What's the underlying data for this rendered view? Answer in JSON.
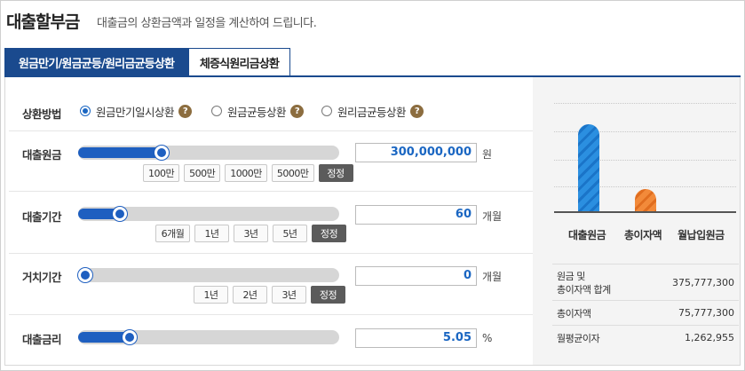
{
  "header": {
    "title": "대출할부금",
    "subtitle": "대출금의 상환금액과 일정을 계산하여 드립니다."
  },
  "tabs": [
    {
      "label": "원금만기/원금균등/원리금균등상환",
      "active": true
    },
    {
      "label": "체증식원리금상환",
      "active": false
    }
  ],
  "repayment": {
    "label": "상환방법",
    "options": [
      {
        "label": "원금만기일시상환",
        "checked": true
      },
      {
        "label": "원금균등상환",
        "checked": false
      },
      {
        "label": "원리금균등상환",
        "checked": false
      }
    ],
    "help_glyph": "?"
  },
  "principal": {
    "label": "대출원금",
    "value": "300,000,000",
    "unit": "원",
    "slider_level": 0.31,
    "buttons": [
      "100만",
      "500만",
      "1000만",
      "5000만"
    ],
    "reset": "정정"
  },
  "term": {
    "label": "대출기간",
    "value": "60",
    "unit": "개월",
    "slider_level": 0.14,
    "buttons": [
      "6개월",
      "1년",
      "3년",
      "5년"
    ],
    "reset": "정정"
  },
  "grace": {
    "label": "거치기간",
    "value": "0",
    "unit": "개월",
    "slider_level": 0.0,
    "buttons": [
      "1년",
      "2년",
      "3년"
    ],
    "reset": "정정"
  },
  "rate": {
    "label": "대출금리",
    "value": "5.05",
    "unit": "%",
    "slider_level": 0.18
  },
  "chart_data": {
    "type": "bar",
    "categories": [
      "대출원금",
      "총이자액",
      "월납입원금"
    ],
    "values": [
      300000000,
      75777300,
      0
    ],
    "colors": [
      "#2b8fe0",
      "#f28a3a",
      "#2b8fe0"
    ]
  },
  "summary": [
    {
      "label_lines": [
        "원금 및",
        "총이자액 합계"
      ],
      "value": "375,777,300"
    },
    {
      "label_lines": [
        "총이자액"
      ],
      "value": "75,777,300"
    },
    {
      "label_lines": [
        "월평균이자"
      ],
      "value": "1,262,955"
    }
  ]
}
